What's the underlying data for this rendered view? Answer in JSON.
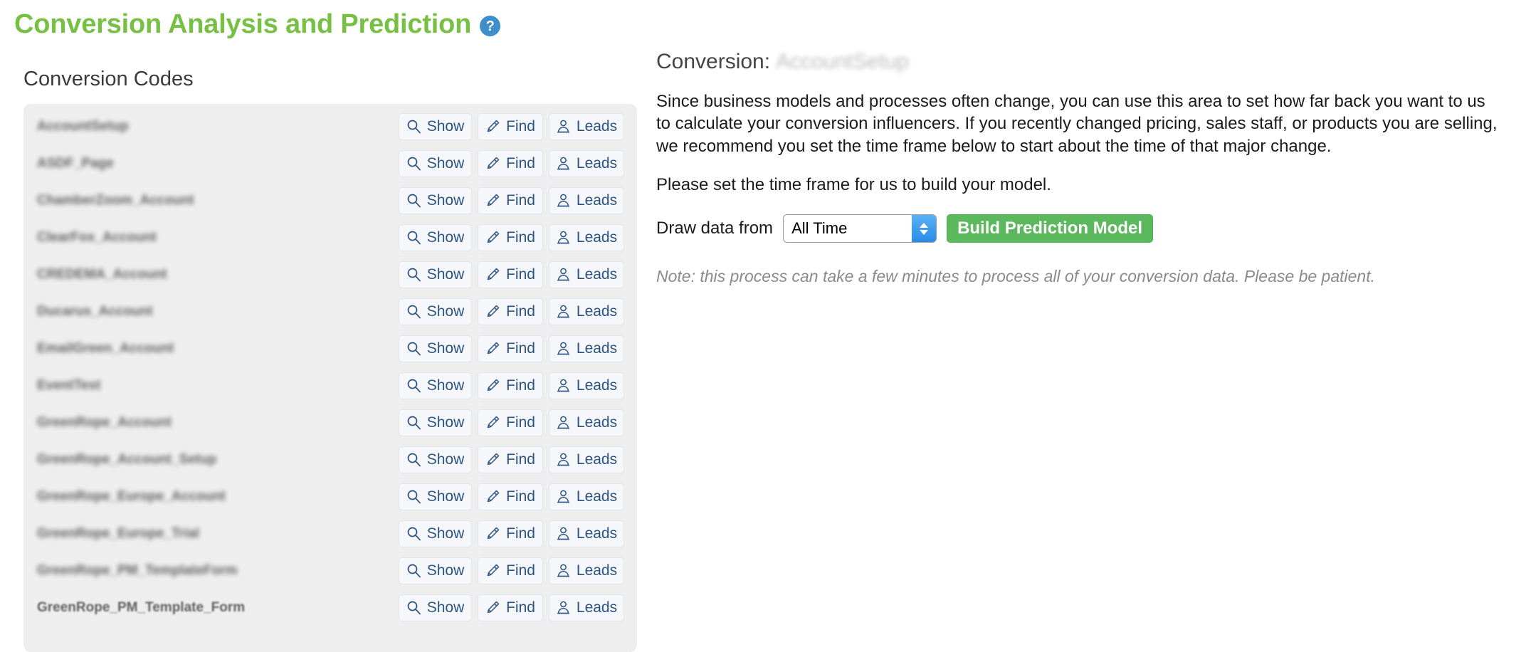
{
  "header": {
    "title": "Conversion Analysis and Prediction",
    "help_icon_label": "?",
    "accent_green": "#76c043",
    "help_blue": "#3f8dcb"
  },
  "left_panel": {
    "heading": "Conversion Codes",
    "actions": {
      "show_label": "Show",
      "find_label": "Find",
      "leads_label": "Leads"
    },
    "codes": [
      {
        "name": "AccountSetup"
      },
      {
        "name": "ASDF_Page"
      },
      {
        "name": "ChamberZoom_Account"
      },
      {
        "name": "ClearFox_Account"
      },
      {
        "name": "CREDEMA_Account"
      },
      {
        "name": "Ducarus_Account"
      },
      {
        "name": "EmailGreen_Account"
      },
      {
        "name": "EventTest"
      },
      {
        "name": "GreenRope_Account"
      },
      {
        "name": "GreenRope_Account_Setup"
      },
      {
        "name": "GreenRope_Europe_Account"
      },
      {
        "name": "GreenRope_Europe_Trial"
      },
      {
        "name": "GreenRope_PM_TemplateForm"
      },
      {
        "name": "GreenRope_PM_Template_Form"
      }
    ]
  },
  "right_panel": {
    "conversion_label": "Conversion:",
    "conversion_value": "AccountSetup",
    "paragraph_1": "Since business models and processes often change, you can use this area to set how far back you want to us to calculate your conversion influencers. If you recently changed pricing, sales staff, or products you are selling, we recommend you set the time frame below to start about the time of that major change.",
    "paragraph_2": "Please set the time frame for us to build your model.",
    "form": {
      "draw_label": "Draw data from",
      "selected_range": "All Time",
      "range_options": [
        "All Time"
      ],
      "build_button": "Build Prediction Model",
      "build_button_color": "#5cb85c"
    },
    "note": "Note: this process can take a few minutes to process all of your conversion data. Please be patient."
  }
}
